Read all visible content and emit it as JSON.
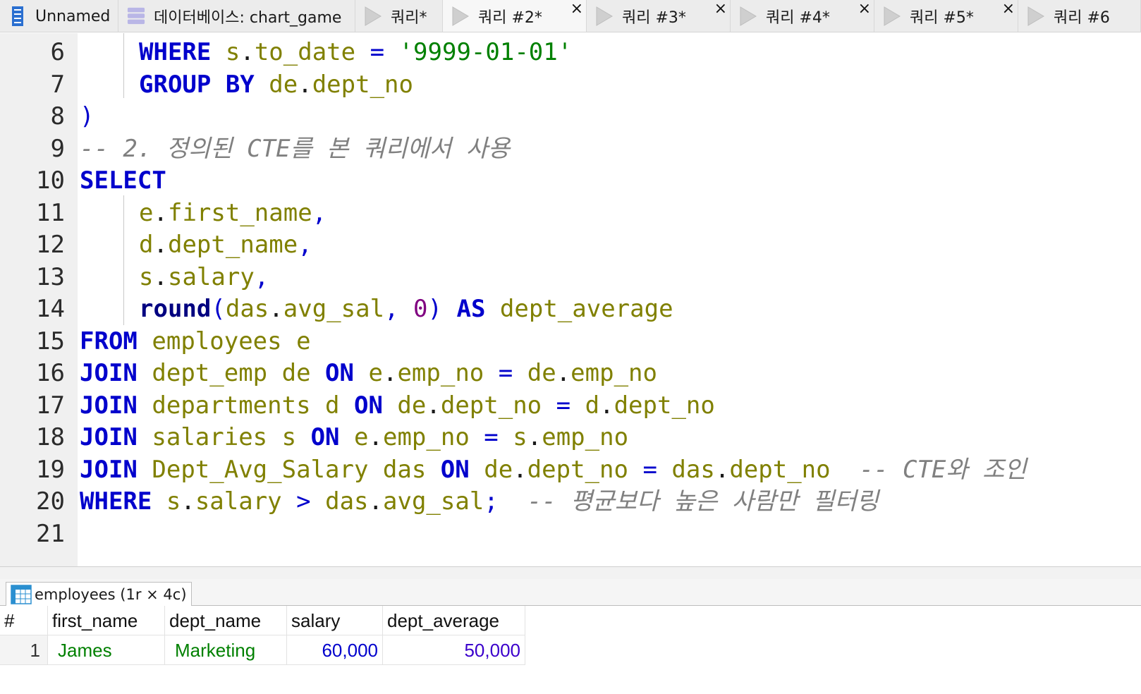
{
  "tabs": [
    {
      "label": "Unnamed",
      "icon": "server-icon",
      "closable": false
    },
    {
      "label": "데이터베이스: chart_game",
      "icon": "database-icon",
      "closable": false
    },
    {
      "label": "쿼리*",
      "icon": "play-icon",
      "closable": false
    },
    {
      "label": "쿼리 #2*",
      "icon": "play-icon",
      "closable": true
    },
    {
      "label": "쿼리 #3*",
      "icon": "play-icon",
      "closable": true
    },
    {
      "label": "쿼리 #4*",
      "icon": "play-icon",
      "closable": true
    },
    {
      "label": "쿼리 #5*",
      "icon": "play-icon",
      "closable": true
    },
    {
      "label": "쿼리 #6",
      "icon": "play-icon",
      "closable": false
    }
  ],
  "close_glyph": "×",
  "editor": {
    "lines": [
      {
        "n": "6",
        "indent": true,
        "tokens": [
          {
            "c": "kw",
            "t": "WHERE"
          },
          {
            "c": "pun",
            "t": " "
          },
          {
            "c": "id",
            "t": "s"
          },
          {
            "c": "pun",
            "t": "."
          },
          {
            "c": "id",
            "t": "to_date"
          },
          {
            "c": "pun",
            "t": " "
          },
          {
            "c": "op",
            "t": "="
          },
          {
            "c": "pun",
            "t": " "
          },
          {
            "c": "str",
            "t": "'9999-01-01'"
          }
        ]
      },
      {
        "n": "7",
        "indent": true,
        "tokens": [
          {
            "c": "kw",
            "t": "GROUP BY"
          },
          {
            "c": "pun",
            "t": " "
          },
          {
            "c": "id",
            "t": "de"
          },
          {
            "c": "pun",
            "t": "."
          },
          {
            "c": "id",
            "t": "dept_no"
          }
        ]
      },
      {
        "n": "8",
        "indent": false,
        "tokens": [
          {
            "c": "par",
            "t": ")"
          }
        ]
      },
      {
        "n": "9",
        "indent": false,
        "tokens": [
          {
            "c": "cmt",
            "t": "-- 2. 정의된 CTE를 본 쿼리에서 사용"
          }
        ]
      },
      {
        "n": "10",
        "indent": false,
        "tokens": [
          {
            "c": "kw",
            "t": "SELECT"
          }
        ]
      },
      {
        "n": "11",
        "indent": true,
        "tokens": [
          {
            "c": "id",
            "t": "e"
          },
          {
            "c": "pun",
            "t": "."
          },
          {
            "c": "id",
            "t": "first_name"
          },
          {
            "c": "op",
            "t": ","
          }
        ]
      },
      {
        "n": "12",
        "indent": true,
        "tokens": [
          {
            "c": "id",
            "t": "d"
          },
          {
            "c": "pun",
            "t": "."
          },
          {
            "c": "id",
            "t": "dept_name"
          },
          {
            "c": "op",
            "t": ","
          }
        ]
      },
      {
        "n": "13",
        "indent": true,
        "tokens": [
          {
            "c": "id",
            "t": "s"
          },
          {
            "c": "pun",
            "t": "."
          },
          {
            "c": "id",
            "t": "salary"
          },
          {
            "c": "op",
            "t": ","
          }
        ]
      },
      {
        "n": "14",
        "indent": true,
        "tokens": [
          {
            "c": "fn",
            "t": "round"
          },
          {
            "c": "par",
            "t": "("
          },
          {
            "c": "id",
            "t": "das"
          },
          {
            "c": "pun",
            "t": "."
          },
          {
            "c": "id",
            "t": "avg_sal"
          },
          {
            "c": "op",
            "t": ","
          },
          {
            "c": "pun",
            "t": " "
          },
          {
            "c": "numl",
            "t": "0"
          },
          {
            "c": "par",
            "t": ")"
          },
          {
            "c": "pun",
            "t": " "
          },
          {
            "c": "kw",
            "t": "AS"
          },
          {
            "c": "pun",
            "t": " "
          },
          {
            "c": "id",
            "t": "dept_average"
          }
        ]
      },
      {
        "n": "15",
        "indent": false,
        "tokens": [
          {
            "c": "kw",
            "t": "FROM"
          },
          {
            "c": "pun",
            "t": " "
          },
          {
            "c": "id",
            "t": "employees e"
          }
        ]
      },
      {
        "n": "16",
        "indent": false,
        "tokens": [
          {
            "c": "kw",
            "t": "JOIN"
          },
          {
            "c": "pun",
            "t": " "
          },
          {
            "c": "id",
            "t": "dept_emp de"
          },
          {
            "c": "pun",
            "t": " "
          },
          {
            "c": "kw",
            "t": "ON"
          },
          {
            "c": "pun",
            "t": " "
          },
          {
            "c": "id",
            "t": "e"
          },
          {
            "c": "pun",
            "t": "."
          },
          {
            "c": "id",
            "t": "emp_no"
          },
          {
            "c": "pun",
            "t": " "
          },
          {
            "c": "op",
            "t": "="
          },
          {
            "c": "pun",
            "t": " "
          },
          {
            "c": "id",
            "t": "de"
          },
          {
            "c": "pun",
            "t": "."
          },
          {
            "c": "id",
            "t": "emp_no"
          }
        ]
      },
      {
        "n": "17",
        "indent": false,
        "tokens": [
          {
            "c": "kw",
            "t": "JOIN"
          },
          {
            "c": "pun",
            "t": " "
          },
          {
            "c": "id",
            "t": "departments d"
          },
          {
            "c": "pun",
            "t": " "
          },
          {
            "c": "kw",
            "t": "ON"
          },
          {
            "c": "pun",
            "t": " "
          },
          {
            "c": "id",
            "t": "de"
          },
          {
            "c": "pun",
            "t": "."
          },
          {
            "c": "id",
            "t": "dept_no"
          },
          {
            "c": "pun",
            "t": " "
          },
          {
            "c": "op",
            "t": "="
          },
          {
            "c": "pun",
            "t": " "
          },
          {
            "c": "id",
            "t": "d"
          },
          {
            "c": "pun",
            "t": "."
          },
          {
            "c": "id",
            "t": "dept_no"
          }
        ]
      },
      {
        "n": "18",
        "indent": false,
        "tokens": [
          {
            "c": "kw",
            "t": "JOIN"
          },
          {
            "c": "pun",
            "t": " "
          },
          {
            "c": "id",
            "t": "salaries s"
          },
          {
            "c": "pun",
            "t": " "
          },
          {
            "c": "kw",
            "t": "ON"
          },
          {
            "c": "pun",
            "t": " "
          },
          {
            "c": "id",
            "t": "e"
          },
          {
            "c": "pun",
            "t": "."
          },
          {
            "c": "id",
            "t": "emp_no"
          },
          {
            "c": "pun",
            "t": " "
          },
          {
            "c": "op",
            "t": "="
          },
          {
            "c": "pun",
            "t": " "
          },
          {
            "c": "id",
            "t": "s"
          },
          {
            "c": "pun",
            "t": "."
          },
          {
            "c": "id",
            "t": "emp_no"
          }
        ]
      },
      {
        "n": "19",
        "indent": false,
        "tokens": [
          {
            "c": "kw",
            "t": "JOIN"
          },
          {
            "c": "pun",
            "t": " "
          },
          {
            "c": "id",
            "t": "Dept_Avg_Salary das"
          },
          {
            "c": "pun",
            "t": " "
          },
          {
            "c": "kw",
            "t": "ON"
          },
          {
            "c": "pun",
            "t": " "
          },
          {
            "c": "id",
            "t": "de"
          },
          {
            "c": "pun",
            "t": "."
          },
          {
            "c": "id",
            "t": "dept_no"
          },
          {
            "c": "pun",
            "t": " "
          },
          {
            "c": "op",
            "t": "="
          },
          {
            "c": "pun",
            "t": " "
          },
          {
            "c": "id",
            "t": "das"
          },
          {
            "c": "pun",
            "t": "."
          },
          {
            "c": "id",
            "t": "dept_no"
          },
          {
            "c": "pun",
            "t": "  "
          },
          {
            "c": "cmt",
            "t": "-- CTE와 조인"
          }
        ]
      },
      {
        "n": "20",
        "indent": false,
        "tokens": [
          {
            "c": "kw",
            "t": "WHERE"
          },
          {
            "c": "pun",
            "t": " "
          },
          {
            "c": "id",
            "t": "s"
          },
          {
            "c": "pun",
            "t": "."
          },
          {
            "c": "id",
            "t": "salary"
          },
          {
            "c": "pun",
            "t": " "
          },
          {
            "c": "op",
            "t": ">"
          },
          {
            "c": "pun",
            "t": " "
          },
          {
            "c": "id",
            "t": "das"
          },
          {
            "c": "pun",
            "t": "."
          },
          {
            "c": "id",
            "t": "avg_sal"
          },
          {
            "c": "op",
            "t": ";"
          },
          {
            "c": "pun",
            "t": "  "
          },
          {
            "c": "cmt",
            "t": "-- 평균보다 높은 사람만 필터링"
          }
        ]
      },
      {
        "n": "21",
        "indent": false,
        "tokens": []
      }
    ]
  },
  "results": {
    "tab_label": "employees (1r × 4c)",
    "columns": [
      "#",
      "first_name",
      "dept_name",
      "salary",
      "dept_average"
    ],
    "rows": [
      [
        "1",
        "James",
        "Marketing",
        "60,000",
        "50,000"
      ]
    ]
  },
  "colors": {
    "keyword": "#0000cc",
    "identifier": "#808000",
    "string": "#008000",
    "number": "#800080",
    "comment": "#808080"
  }
}
